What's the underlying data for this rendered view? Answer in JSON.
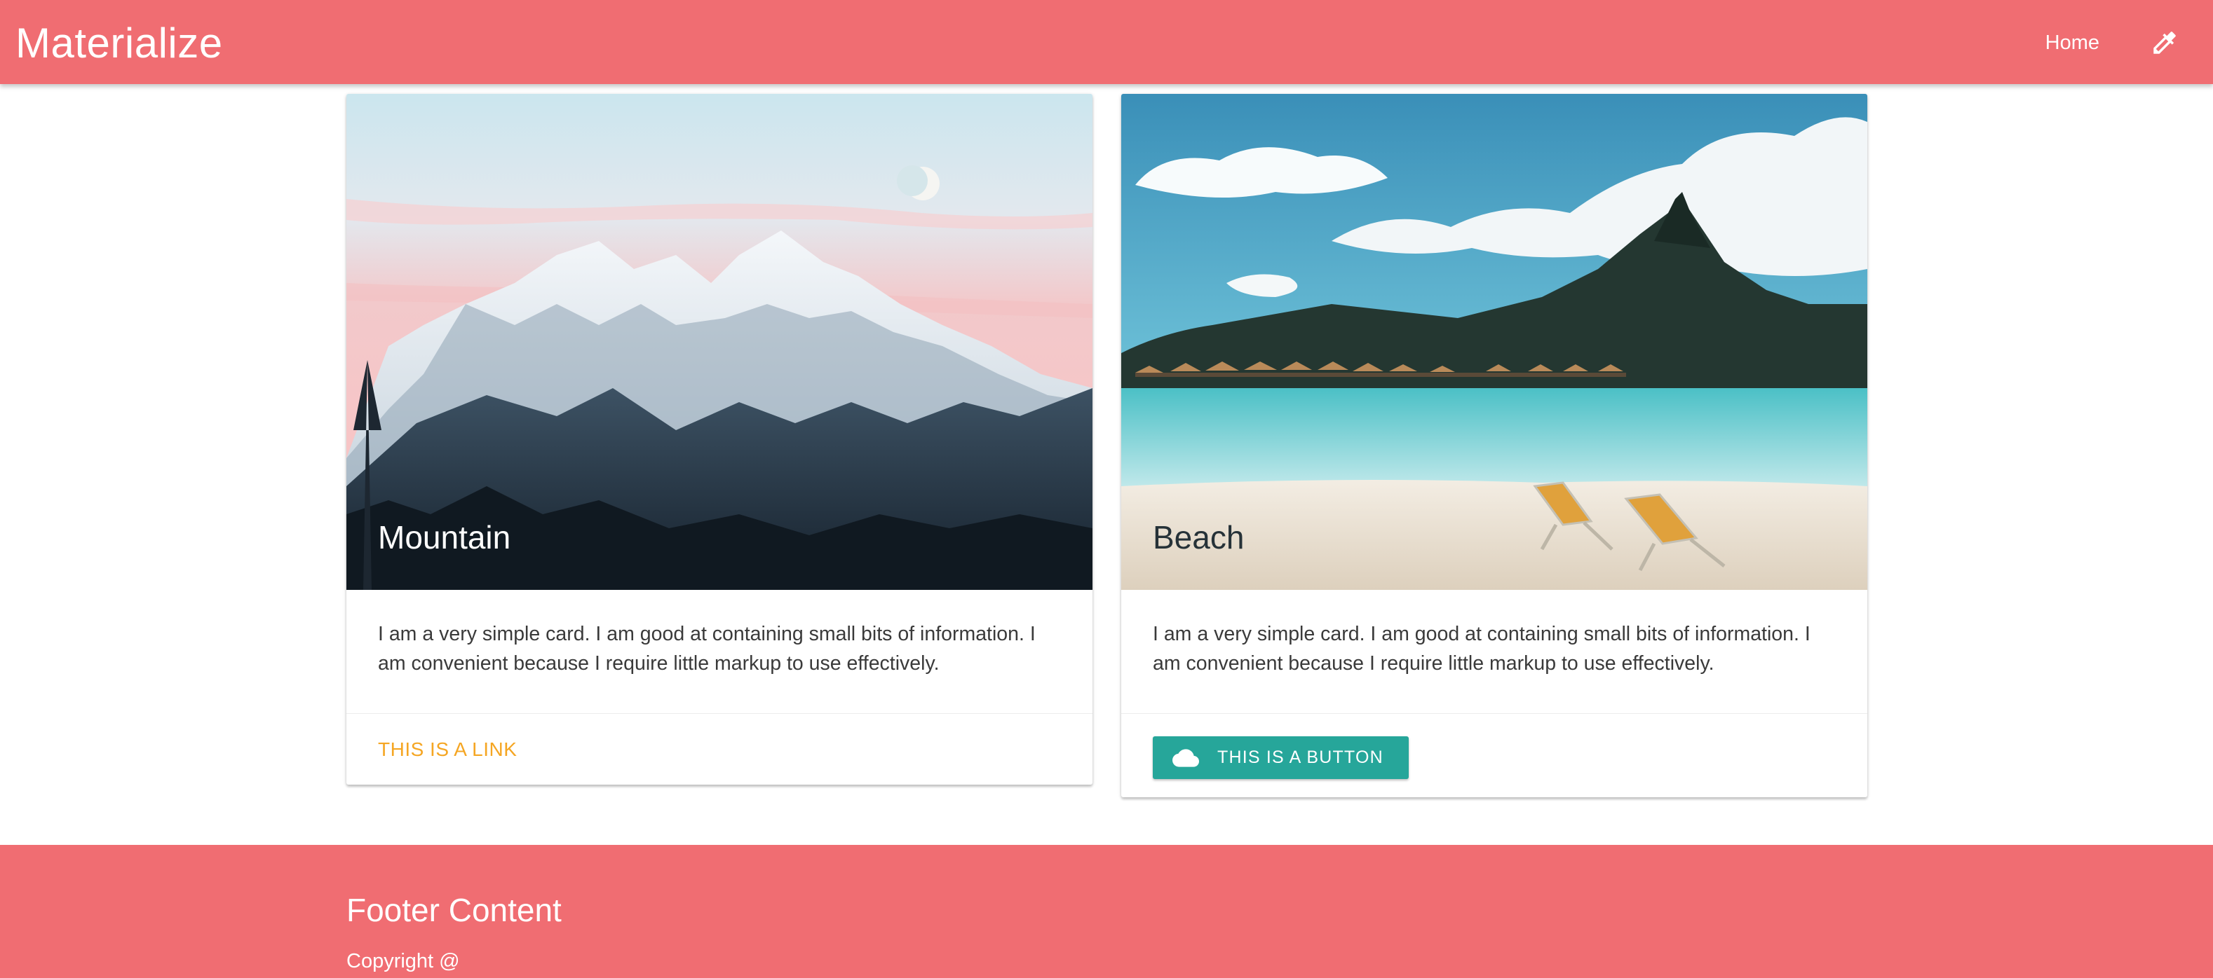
{
  "navbar": {
    "brand": "Materialize",
    "links": [
      {
        "label": "Home"
      }
    ],
    "icon": "eyedropper-icon",
    "bg_color": "#f06d72"
  },
  "cards": [
    {
      "title": "Mountain",
      "image": "snowy-mountain-photo",
      "content": "I am a very simple card. I am good at containing small bits of information. I am convenient because I require little markup to use effectively.",
      "action": {
        "type": "link",
        "label": "THIS IS A LINK",
        "color": "#f5a623"
      }
    },
    {
      "title": "Beach",
      "image": "tropical-beach-photo",
      "content": "I am a very simple card. I am good at containing small bits of information. I am convenient because I require little markup to use effectively.",
      "action": {
        "type": "button",
        "label": "THIS IS A BUTTON",
        "icon": "cloud-icon",
        "color": "#26a69a"
      }
    }
  ],
  "footer": {
    "title": "Footer Content",
    "copyright": "Copyright @",
    "bg_color": "#f06d72"
  }
}
